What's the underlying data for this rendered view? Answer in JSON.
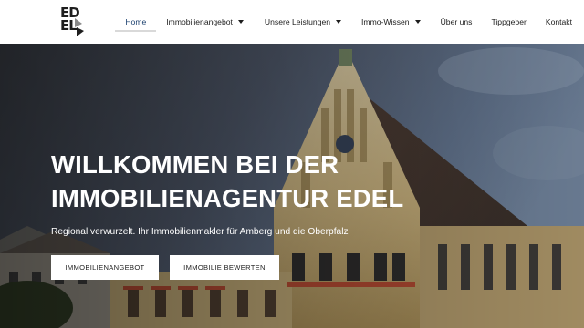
{
  "brand": {
    "logo_line1": "ED",
    "logo_line2": "EL"
  },
  "nav": {
    "items": [
      {
        "label": "Home",
        "active": true,
        "dropdown": false
      },
      {
        "label": "Immobilienangebot",
        "dropdown": true
      },
      {
        "label": "Unsere Leistungen",
        "dropdown": true
      },
      {
        "label": "Immo-Wissen",
        "dropdown": true
      },
      {
        "label": "Über uns",
        "dropdown": false
      },
      {
        "label": "Tippgeber",
        "dropdown": false
      },
      {
        "label": "Kontakt",
        "dropdown": false
      }
    ]
  },
  "hero": {
    "headline_line1": "WILLKOMMEN BEI DER",
    "headline_line2": "IMMOBILIENAGENTUR EDEL",
    "subline": "Regional verwurzelt. Ihr Immobilienmakler für Amberg und die Oberpfalz",
    "buttons": [
      "IMMOBILIENANGEBOT",
      "IMMOBILIE BEWERTEN"
    ]
  },
  "colors": {
    "nav_active": "#1a3f6e",
    "nav_text": "#1d1d1d",
    "hero_text": "#ffffff",
    "button_bg": "#ffffff"
  }
}
